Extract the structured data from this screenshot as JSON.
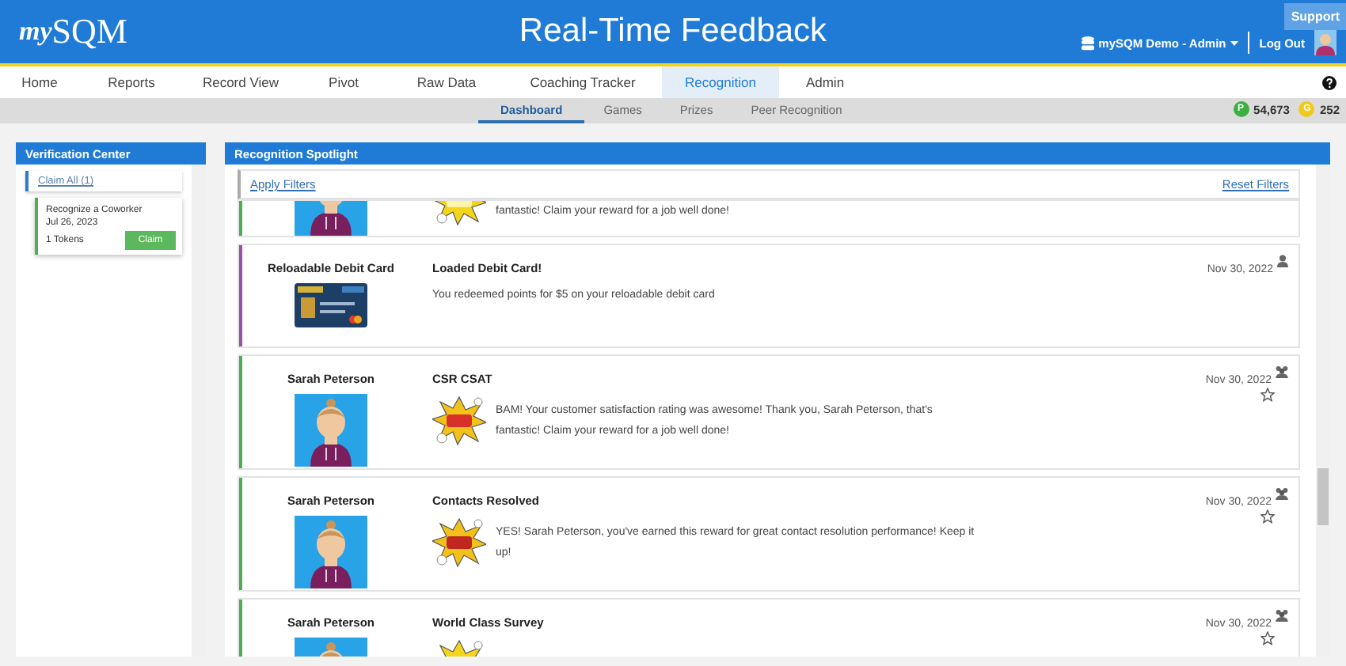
{
  "header": {
    "title": "Real-Time Feedback",
    "logo": {
      "prefix": "my",
      "brand": "SQM"
    },
    "support": "Support",
    "account": "mySQM Demo - Admin",
    "logout": "Log Out"
  },
  "nav": [
    {
      "label": "Home",
      "selected": false
    },
    {
      "label": "Reports",
      "selected": false
    },
    {
      "label": "Record View",
      "selected": false
    },
    {
      "label": "Pivot",
      "selected": false
    },
    {
      "label": "Raw Data",
      "selected": false
    },
    {
      "label": "Coaching Tracker",
      "selected": false
    },
    {
      "label": "Recognition",
      "selected": true
    },
    {
      "label": "Admin",
      "selected": false
    }
  ],
  "subnav": [
    {
      "label": "Dashboard",
      "selected": true
    },
    {
      "label": "Games",
      "selected": false
    },
    {
      "label": "Prizes",
      "selected": false
    },
    {
      "label": "Peer Recognition",
      "selected": false
    }
  ],
  "balances": [
    {
      "badge": "P",
      "value": "54,673",
      "color": "#3cb043"
    },
    {
      "badge": "G",
      "value": "252",
      "color": "#f2c81b"
    }
  ],
  "verification": {
    "title": "Verification Center",
    "claim_all": "Claim All (1)",
    "items": [
      {
        "title": "Recognize a Coworker",
        "date": "Jul 26, 2023",
        "tokens": "1 Tokens",
        "action": "Claim"
      }
    ]
  },
  "spotlight": {
    "title": "Recognition Spotlight",
    "apply": "Apply Filters",
    "reset": "Reset Filters",
    "cards": [
      {
        "kind": "cut_top",
        "color": "#4caf50",
        "message": "fantastic! Claim your reward for a job well done!"
      },
      {
        "kind": "prize",
        "color": "#9b4fa8",
        "name": "Reloadable Debit Card",
        "title": "Loaded Debit Card!",
        "message": "You redeemed points for $5 on your reloadable debit card",
        "date": "Nov 30, 2022"
      },
      {
        "kind": "award",
        "color": "#4caf50",
        "name": "Sarah Peterson",
        "title": "CSR CSAT",
        "message": "BAM! Your customer satisfaction rating was awesome! Thank you, Sarah Peterson, that's fantastic! Claim your reward for a job well done!",
        "date": "Nov 30, 2022",
        "favorite": false
      },
      {
        "kind": "award",
        "color": "#4caf50",
        "name": "Sarah Peterson",
        "title": "Contacts Resolved",
        "message": "YES! Sarah Peterson, you've earned this reward for great contact resolution performance! Keep it up!",
        "date": "Nov 30, 2022",
        "favorite": false
      },
      {
        "kind": "award",
        "color": "#4caf50",
        "name": "Sarah Peterson",
        "title": "World Class Survey",
        "date": "Nov 30, 2022",
        "favorite": false
      }
    ]
  }
}
